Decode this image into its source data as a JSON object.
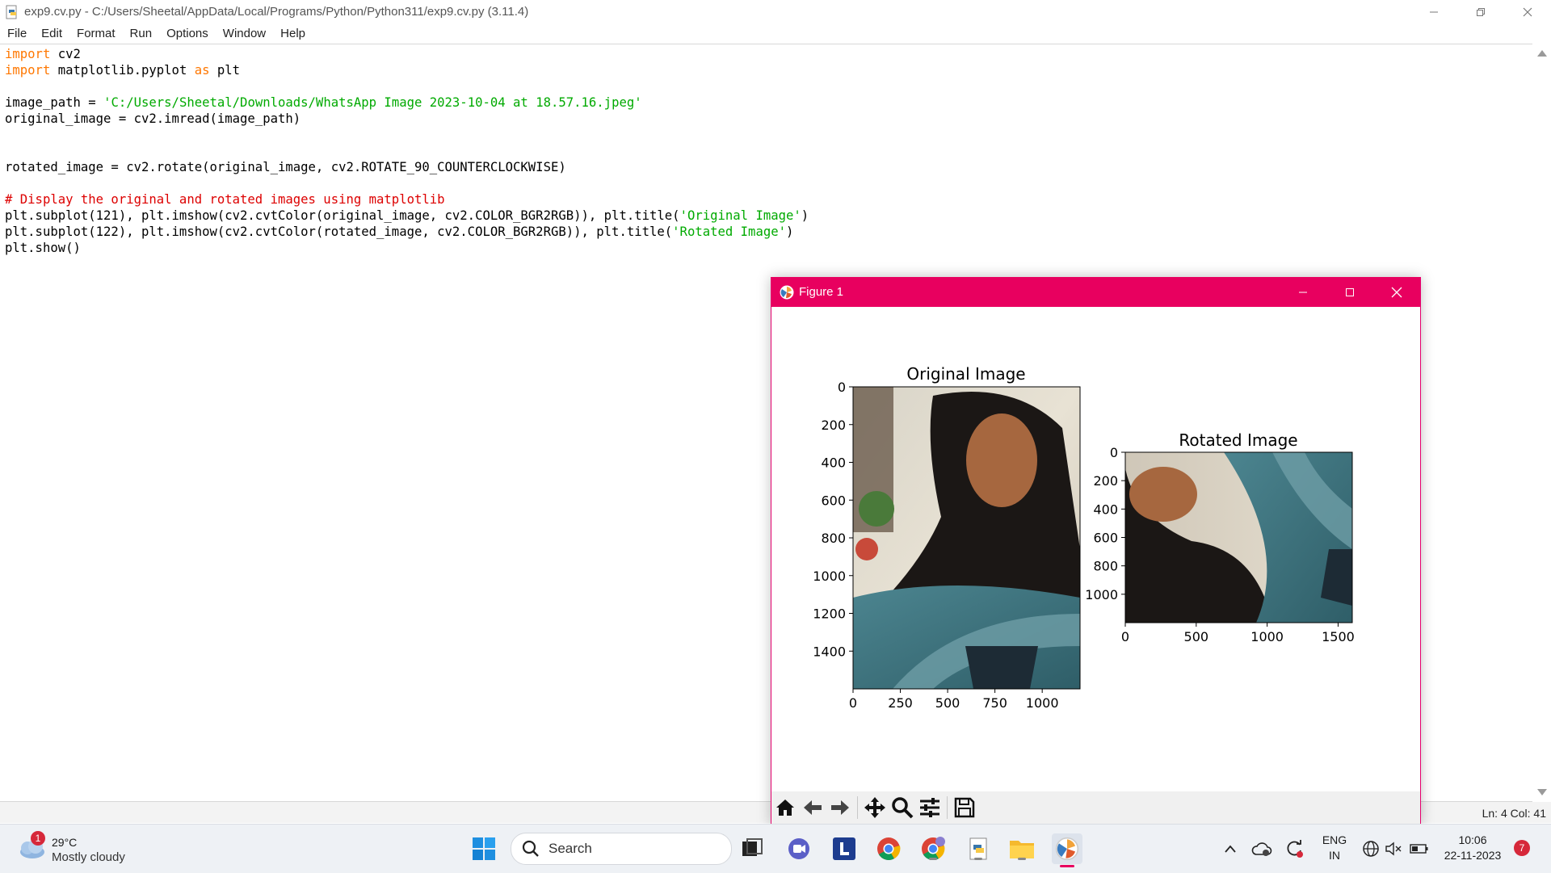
{
  "window": {
    "title": "exp9.cv.py - C:/Users/Sheetal/AppData/Local/Programs/Python/Python311/exp9.cv.py (3.11.4)"
  },
  "menu": [
    "File",
    "Edit",
    "Format",
    "Run",
    "Options",
    "Window",
    "Help"
  ],
  "code": {
    "l1_kw": "import",
    "l1_rest": " cv2",
    "l2_kw": "import",
    "l2_mid": " matplotlib.pyplot ",
    "l2_kw2": "as",
    "l2_rest": " plt",
    "l4_a": "image_path = ",
    "l4_str": "'C:/Users/Sheetal/Downloads/WhatsApp Image 2023-10-04 at 18.57.16.jpeg'",
    "l5": "original_image = cv2.imread(image_path)",
    "l8": "rotated_image = cv2.rotate(original_image, cv2.ROTATE_90_COUNTERCLOCKWISE)",
    "l10_com": "# Display the original and rotated images using matplotlib",
    "l11_a": "plt.subplot(121), plt.imshow(cv2.cvtColor(original_image, cv2.COLOR_BGR2RGB)), plt.title(",
    "l11_str": "'Original Image'",
    "l11_b": ")",
    "l12_a": "plt.subplot(122), plt.imshow(cv2.cvtColor(rotated_image, cv2.COLOR_BGR2RGB)), plt.title(",
    "l12_str": "'Rotated Image'",
    "l12_b": ")",
    "l13": "plt.show()"
  },
  "status": {
    "position": "Ln: 4   Col: 41"
  },
  "figure": {
    "title": "Figure 1",
    "toolbar_icons": [
      "home-icon",
      "back-arrow-icon",
      "forward-arrow-icon",
      "pan-icon",
      "zoom-icon",
      "configure-subplots-icon",
      "save-icon"
    ]
  },
  "chart_data": [
    {
      "type": "image",
      "title": "Original Image",
      "x_ticks": [
        "0",
        "250",
        "500",
        "750",
        "1000"
      ],
      "y_ticks": [
        "0",
        "200",
        "400",
        "600",
        "800",
        "1000",
        "1200",
        "1400"
      ],
      "xlim": [
        0,
        1200
      ],
      "ylim": [
        1600,
        0
      ]
    },
    {
      "type": "image",
      "title": "Rotated Image",
      "x_ticks": [
        "0",
        "500",
        "1000",
        "1500"
      ],
      "y_ticks": [
        "0",
        "200",
        "400",
        "600",
        "800",
        "1000"
      ],
      "xlim": [
        0,
        1600
      ],
      "ylim": [
        1200,
        0
      ]
    }
  ],
  "taskbar": {
    "weather": {
      "badge": "1",
      "temp": "29°C",
      "desc": "Mostly cloudy"
    },
    "search_label": "Search",
    "notification_count": "7",
    "lang_top": "ENG",
    "lang_bottom": "IN",
    "time": "10:06",
    "date": "22-11-2023"
  },
  "colors": {
    "figure_titlebar": "#e8005f",
    "keyword": "#ff7700",
    "string": "#00aa00",
    "comment": "#dd0000"
  }
}
